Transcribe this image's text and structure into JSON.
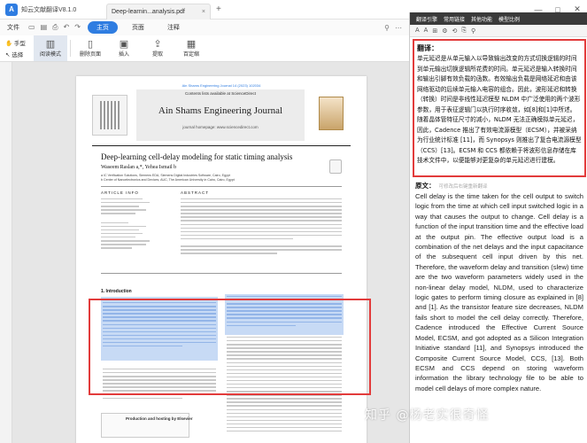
{
  "app": {
    "logo_letter": "A",
    "title": "知云文献翻译V8.1.0"
  },
  "tab": {
    "filename": "Deep-learnin...analysis.pdf",
    "close": "×",
    "add": "+"
  },
  "window": {
    "minimize": "—",
    "maximize": "□",
    "close": "✕"
  },
  "menu": {
    "file": "文件",
    "tabs": [
      "主页",
      "页面",
      "注释"
    ],
    "active_tab": "主页"
  },
  "toolbar": {
    "hand": "手型",
    "select": "选择",
    "buttons": [
      {
        "label": "阅读模式",
        "icon": "book-icon"
      },
      {
        "label": "删除页面",
        "icon": "delete-page-icon"
      },
      {
        "label": "插入",
        "icon": "insert-icon"
      },
      {
        "label": "提取",
        "icon": "extract-icon"
      },
      {
        "label": "百定缩",
        "icon": "zoom-icon"
      }
    ]
  },
  "paper": {
    "doi_line": "Ain Shams Engineering Journal 14 (2023) 102034",
    "contents": "Contents lists available at ScienceDirect",
    "journal": "Ain Shams Engineering Journal",
    "homepage": "journal homepage: www.sciencedirect.com",
    "title": "Deep-learning cell-delay modeling for static timing analysis",
    "authors": "Waseem Raslan a,*, Yehea Ismail b",
    "affil1": "a IC Verification Solutions, Siemens EDA, Siemens Digital Industries Software, Cairo, Egypt",
    "affil2": "b Center of Nanoelectronics and Devices, AUC, The American University in Cairo, Cairo, Egypt",
    "article_info": "ARTICLE INFO",
    "abstract": "ABSTRACT",
    "intro_heading": "1. Introduction",
    "footer": "Production and hosting by Elsevier"
  },
  "right_panel": {
    "tabs": [
      "翻译引擎",
      "常用链接",
      "其他功能",
      "模型比例"
    ],
    "tools": [
      "A",
      "A",
      "⊞",
      "⚙",
      "⟲",
      "⎘",
      "⚲"
    ],
    "translation_label": "翻译：",
    "translation_text": "单元延迟是从单元输入以导致输出改变的方式切换逻辑的时间到单元输出切换逻辑所花费的时间。单元延迟是输入转换时间和输出引脚有效负载的函数。有效输出负载是网络延迟和由该网络驱动的后续单元输入电容的组合。因此，波形延迟和转换（转换）时间是非线性延迟模型 NLDM 中广泛使用的两个波形参数，用于表征逻辑门以执行时序收敛，如[8]和[1]中所述。随着晶体管特征尺寸的减小，NLDM 无法正确模拟单元延迟，因此，Cadence 推出了有效电流源模型（ECSM），并被采纳为行业统计标准 [11]，而 Synopsys 则推出了复合电流源模型（CCS）[13]。ECSM 和 CCS 都依赖于将波形信息存储在库技术文件中，以便能够对更复杂的单元延迟进行建模。",
    "original_label": "原文：",
    "original_hint": "可修改后右键重新翻译",
    "original_text": "Cell delay is the time taken for the cell output to switch logic from the time at which cell input switched logic in a way that causes the output to change. Cell delay is a function of the input transition time and the effective load at the output pin. The effective output load is a combination of the net delays and the input capacitance of the subsequent cell input driven by this net. Therefore, the waveform delay and transition (slew) time are the two waveform parameters widely used in the non-linear delay model, NLDM, used to characterize logic gates to perform timing closure as explained in [8] and [1]. As the transistor feature size decreases, NLDM fails short to model the cell delay correctly. Therefore, Cadence introduced the Effective Current Source Model, ECSM, and got adopted as a Silicon Integration Initiative standard [11], and Synopsys introduced the Composite Current Source Model, CCS, [13]. Both ECSM and CCS depend on storing waveform information the library technology file to be able to model cell delays of more complex nature."
  },
  "watermark": "知乎 @杨老实很奇怪"
}
